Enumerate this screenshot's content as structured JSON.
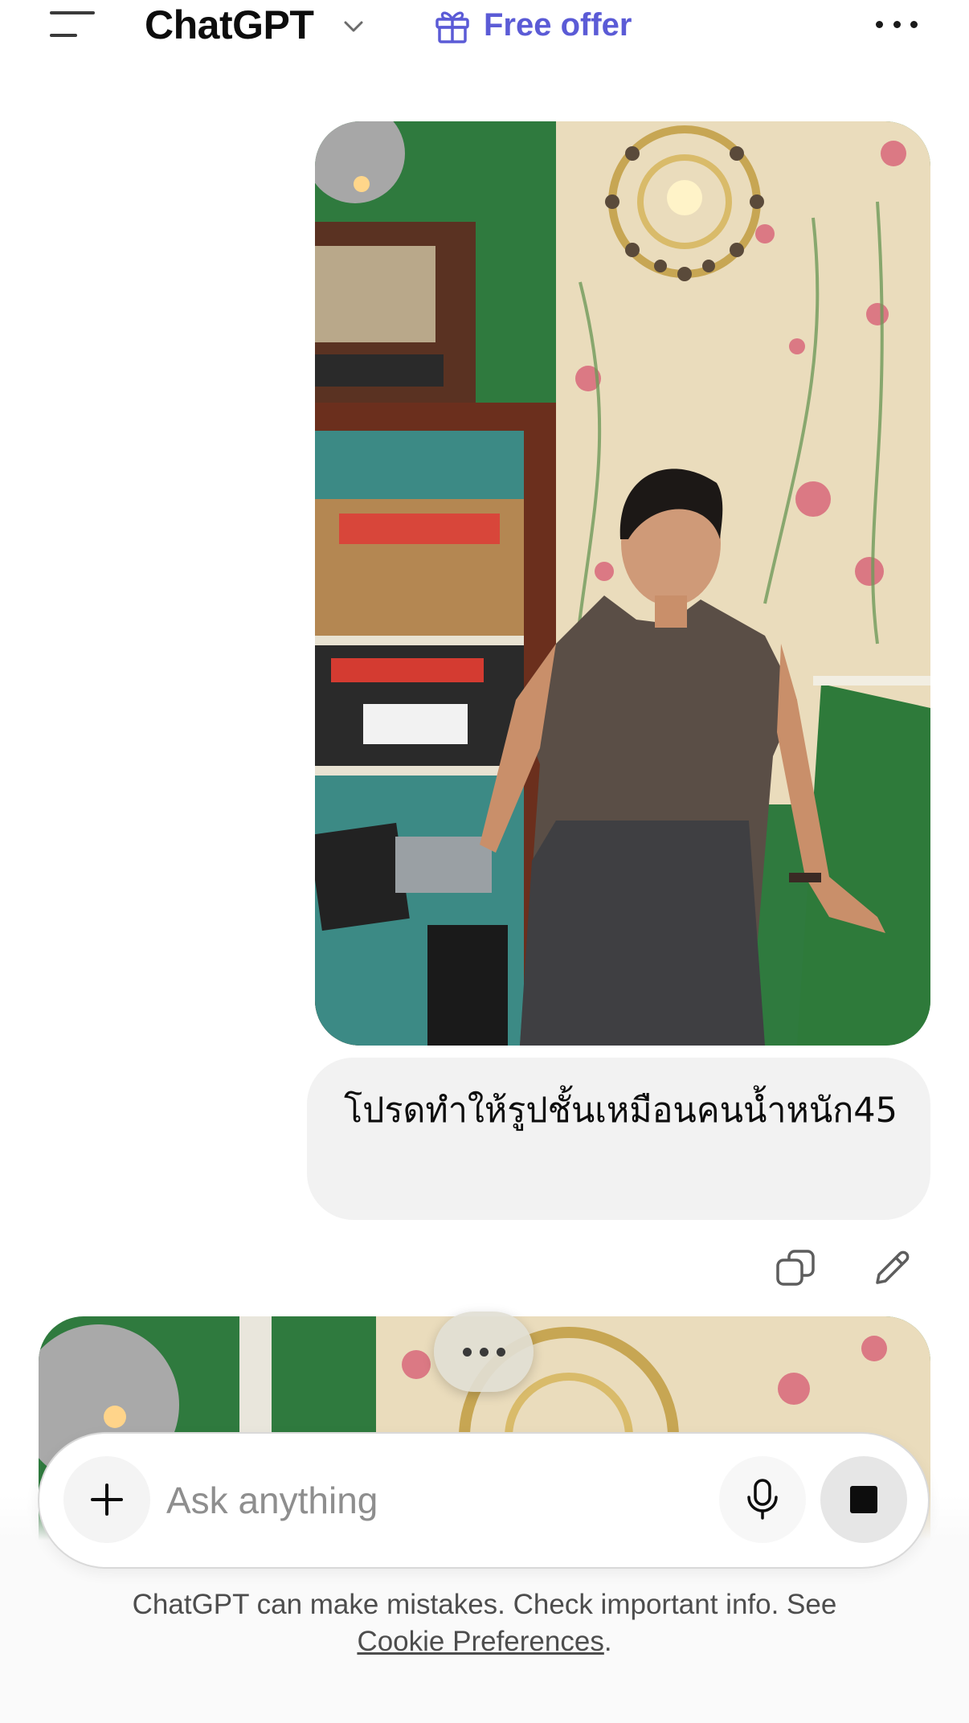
{
  "header": {
    "title": "ChatGPT",
    "offer_label": "Free offer",
    "icons": [
      "menu-icon",
      "chevron-down-icon",
      "gift-icon",
      "more-icon"
    ]
  },
  "conversation": {
    "user_message": "โปรดทำให้รูปชั้นเหมือนคนน้ำหนัก45",
    "message_actions": [
      "copy-icon",
      "edit-icon"
    ]
  },
  "composer": {
    "placeholder": "Ask anything",
    "icons": [
      "plus-icon",
      "microphone-icon",
      "stop-icon"
    ]
  },
  "footer": {
    "disclaimer_text": "ChatGPT can make mistakes. Check important info. See ",
    "cookie_link_label": "Cookie Preferences",
    "disclaimer_end": "."
  },
  "colors": {
    "accent": "#5b5bd6",
    "bubble": "#f2f2f2",
    "background": "#ffffff"
  }
}
